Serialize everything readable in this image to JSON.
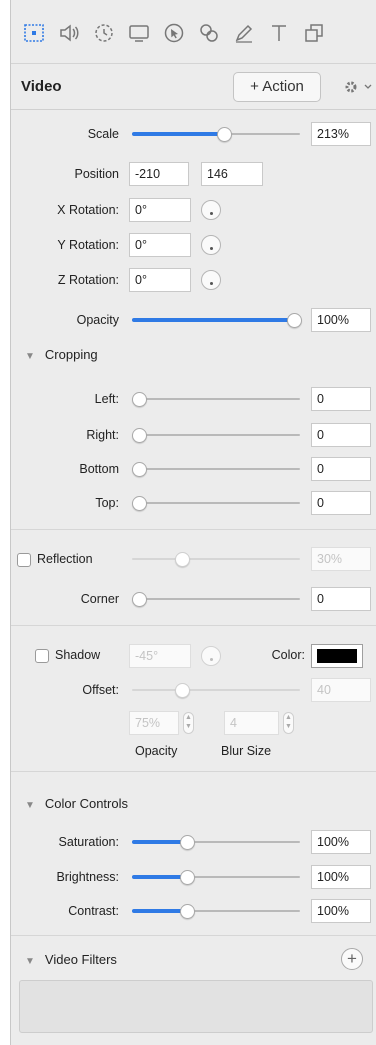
{
  "toolbar": {
    "tools": [
      {
        "icon": "video-inspector-icon",
        "active": true
      },
      {
        "icon": "audio-speaker-icon",
        "active": false
      },
      {
        "icon": "timer-icon",
        "active": false
      },
      {
        "icon": "screen-icon",
        "active": false
      },
      {
        "icon": "cursor-icon",
        "active": false
      },
      {
        "icon": "keys-icon",
        "active": false
      },
      {
        "icon": "pen-annotation-icon",
        "active": false
      },
      {
        "icon": "text-icon",
        "active": false
      },
      {
        "icon": "layers-icon",
        "active": false
      }
    ]
  },
  "header": {
    "title": "Video",
    "action_label": "+ Action",
    "gear_icon": "gear-icon"
  },
  "transform": {
    "scale_label": "Scale",
    "scale_value": "213%",
    "scale_fraction": 0.55,
    "position_label": "Position",
    "position_x": "-210",
    "position_y": "146",
    "x_rotation_label": "X Rotation:",
    "x_rotation_value": "0°",
    "y_rotation_label": "Y Rotation:",
    "y_rotation_value": "0°",
    "z_rotation_label": "Z Rotation:",
    "z_rotation_value": "0°",
    "opacity_label": "Opacity",
    "opacity_value": "100%",
    "opacity_fraction": 1.0
  },
  "cropping": {
    "title": "Cropping",
    "left_label": "Left:",
    "left_value": "0",
    "right_label": "Right:",
    "right_value": "0",
    "bottom_label": "Bottom",
    "bottom_value": "0",
    "top_label": "Top:",
    "top_value": "0"
  },
  "reflection": {
    "label": "Reflection",
    "value": "30%",
    "fraction": 0.3,
    "checked": false,
    "corner_label": "Corner",
    "corner_value": "0"
  },
  "shadow": {
    "label": "Shadow",
    "checked": false,
    "angle_value": "-45°",
    "color_label": "Color:",
    "color": "#000000",
    "offset_label": "Offset:",
    "offset_value": "40",
    "offset_fraction": 0.3,
    "opacity_value": "75%",
    "blur_value": "4",
    "opacity_caption": "Opacity",
    "blur_caption": "Blur Size"
  },
  "color_controls": {
    "title": "Color Controls",
    "saturation_label": "Saturation:",
    "saturation_value": "100%",
    "brightness_label": "Brightness:",
    "brightness_value": "100%",
    "contrast_label": "Contrast:",
    "contrast_value": "100%",
    "slider_fraction": 0.33
  },
  "video_filters": {
    "title": "Video Filters",
    "add_label": "+"
  },
  "colors": {
    "accent": "#2f7ae5",
    "panel_bg": "#ececec"
  }
}
